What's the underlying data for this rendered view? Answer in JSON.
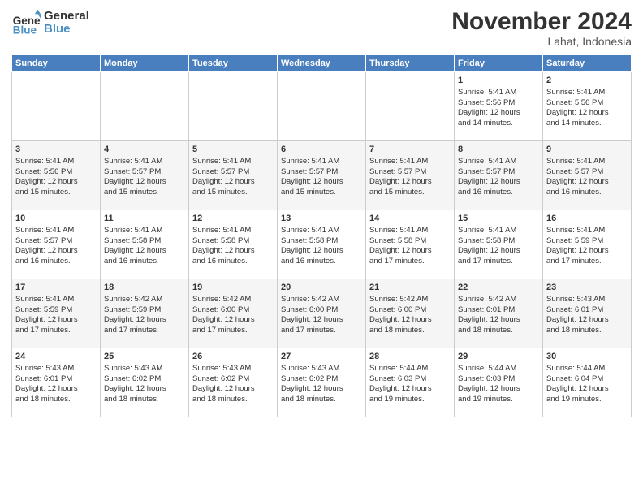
{
  "logo": {
    "line1": "General",
    "line2": "Blue"
  },
  "title": "November 2024",
  "location": "Lahat, Indonesia",
  "days_of_week": [
    "Sunday",
    "Monday",
    "Tuesday",
    "Wednesday",
    "Thursday",
    "Friday",
    "Saturday"
  ],
  "weeks": [
    [
      {
        "day": "",
        "info": ""
      },
      {
        "day": "",
        "info": ""
      },
      {
        "day": "",
        "info": ""
      },
      {
        "day": "",
        "info": ""
      },
      {
        "day": "",
        "info": ""
      },
      {
        "day": "1",
        "info": "Sunrise: 5:41 AM\nSunset: 5:56 PM\nDaylight: 12 hours\nand 14 minutes."
      },
      {
        "day": "2",
        "info": "Sunrise: 5:41 AM\nSunset: 5:56 PM\nDaylight: 12 hours\nand 14 minutes."
      }
    ],
    [
      {
        "day": "3",
        "info": "Sunrise: 5:41 AM\nSunset: 5:56 PM\nDaylight: 12 hours\nand 15 minutes."
      },
      {
        "day": "4",
        "info": "Sunrise: 5:41 AM\nSunset: 5:57 PM\nDaylight: 12 hours\nand 15 minutes."
      },
      {
        "day": "5",
        "info": "Sunrise: 5:41 AM\nSunset: 5:57 PM\nDaylight: 12 hours\nand 15 minutes."
      },
      {
        "day": "6",
        "info": "Sunrise: 5:41 AM\nSunset: 5:57 PM\nDaylight: 12 hours\nand 15 minutes."
      },
      {
        "day": "7",
        "info": "Sunrise: 5:41 AM\nSunset: 5:57 PM\nDaylight: 12 hours\nand 15 minutes."
      },
      {
        "day": "8",
        "info": "Sunrise: 5:41 AM\nSunset: 5:57 PM\nDaylight: 12 hours\nand 16 minutes."
      },
      {
        "day": "9",
        "info": "Sunrise: 5:41 AM\nSunset: 5:57 PM\nDaylight: 12 hours\nand 16 minutes."
      }
    ],
    [
      {
        "day": "10",
        "info": "Sunrise: 5:41 AM\nSunset: 5:57 PM\nDaylight: 12 hours\nand 16 minutes."
      },
      {
        "day": "11",
        "info": "Sunrise: 5:41 AM\nSunset: 5:58 PM\nDaylight: 12 hours\nand 16 minutes."
      },
      {
        "day": "12",
        "info": "Sunrise: 5:41 AM\nSunset: 5:58 PM\nDaylight: 12 hours\nand 16 minutes."
      },
      {
        "day": "13",
        "info": "Sunrise: 5:41 AM\nSunset: 5:58 PM\nDaylight: 12 hours\nand 16 minutes."
      },
      {
        "day": "14",
        "info": "Sunrise: 5:41 AM\nSunset: 5:58 PM\nDaylight: 12 hours\nand 17 minutes."
      },
      {
        "day": "15",
        "info": "Sunrise: 5:41 AM\nSunset: 5:58 PM\nDaylight: 12 hours\nand 17 minutes."
      },
      {
        "day": "16",
        "info": "Sunrise: 5:41 AM\nSunset: 5:59 PM\nDaylight: 12 hours\nand 17 minutes."
      }
    ],
    [
      {
        "day": "17",
        "info": "Sunrise: 5:41 AM\nSunset: 5:59 PM\nDaylight: 12 hours\nand 17 minutes."
      },
      {
        "day": "18",
        "info": "Sunrise: 5:42 AM\nSunset: 5:59 PM\nDaylight: 12 hours\nand 17 minutes."
      },
      {
        "day": "19",
        "info": "Sunrise: 5:42 AM\nSunset: 6:00 PM\nDaylight: 12 hours\nand 17 minutes."
      },
      {
        "day": "20",
        "info": "Sunrise: 5:42 AM\nSunset: 6:00 PM\nDaylight: 12 hours\nand 17 minutes."
      },
      {
        "day": "21",
        "info": "Sunrise: 5:42 AM\nSunset: 6:00 PM\nDaylight: 12 hours\nand 18 minutes."
      },
      {
        "day": "22",
        "info": "Sunrise: 5:42 AM\nSunset: 6:01 PM\nDaylight: 12 hours\nand 18 minutes."
      },
      {
        "day": "23",
        "info": "Sunrise: 5:43 AM\nSunset: 6:01 PM\nDaylight: 12 hours\nand 18 minutes."
      }
    ],
    [
      {
        "day": "24",
        "info": "Sunrise: 5:43 AM\nSunset: 6:01 PM\nDaylight: 12 hours\nand 18 minutes."
      },
      {
        "day": "25",
        "info": "Sunrise: 5:43 AM\nSunset: 6:02 PM\nDaylight: 12 hours\nand 18 minutes."
      },
      {
        "day": "26",
        "info": "Sunrise: 5:43 AM\nSunset: 6:02 PM\nDaylight: 12 hours\nand 18 minutes."
      },
      {
        "day": "27",
        "info": "Sunrise: 5:43 AM\nSunset: 6:02 PM\nDaylight: 12 hours\nand 18 minutes."
      },
      {
        "day": "28",
        "info": "Sunrise: 5:44 AM\nSunset: 6:03 PM\nDaylight: 12 hours\nand 19 minutes."
      },
      {
        "day": "29",
        "info": "Sunrise: 5:44 AM\nSunset: 6:03 PM\nDaylight: 12 hours\nand 19 minutes."
      },
      {
        "day": "30",
        "info": "Sunrise: 5:44 AM\nSunset: 6:04 PM\nDaylight: 12 hours\nand 19 minutes."
      }
    ]
  ]
}
